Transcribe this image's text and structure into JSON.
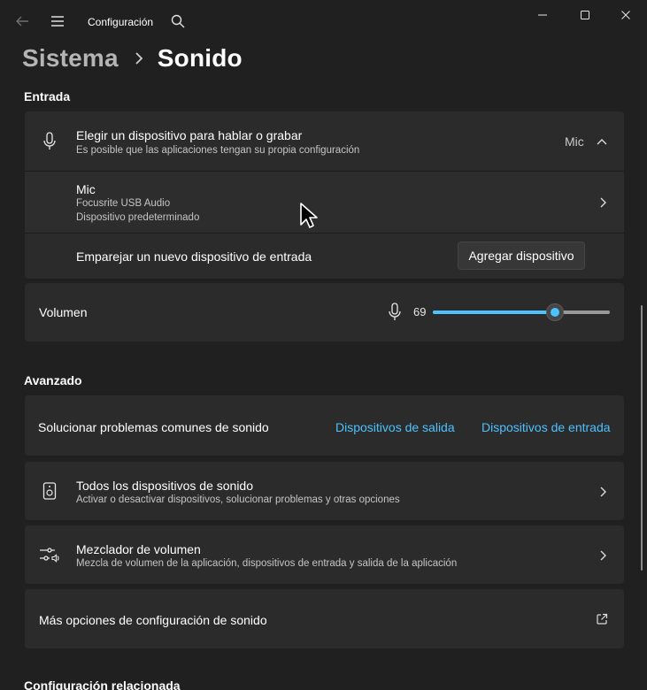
{
  "window": {
    "title": "Configuración",
    "controls": {
      "minimize": "minimize-icon",
      "maximize": "maximize-icon",
      "close": "close-icon"
    }
  },
  "breadcrumb": {
    "parent": "Sistema",
    "current": "Sonido"
  },
  "input_section": {
    "title": "Entrada",
    "device_chooser": {
      "title": "Elegir un dispositivo para hablar o grabar",
      "subtitle": "Es posible que las aplicaciones tengan su propia configuración",
      "selected": "Mic"
    },
    "device": {
      "name": "Mic",
      "detail1": "Focusrite USB Audio",
      "detail2": "Dispositivo predeterminado"
    },
    "pair": {
      "label": "Emparejar un nuevo dispositivo de entrada",
      "button": "Agregar dispositivo"
    },
    "volume": {
      "label": "Volumen",
      "value": "69",
      "level": 69
    }
  },
  "advanced_section": {
    "title": "Avanzado",
    "troubleshoot": {
      "label": "Solucionar problemas comunes de sonido",
      "link_output": "Dispositivos de salida",
      "link_input": "Dispositivos de entrada"
    },
    "all_devices": {
      "title": "Todos los dispositivos de sonido",
      "subtitle": "Activar o desactivar dispositivos, solucionar problemas y otras opciones"
    },
    "mixer": {
      "title": "Mezclador de volumen",
      "subtitle": "Mezcla de volumen de la aplicación, dispositivos de entrada y salida de la aplicación"
    },
    "more_options": {
      "label": "Más opciones de configuración de sonido"
    }
  },
  "related_section": {
    "title": "Configuración relacionada"
  },
  "colors": {
    "background": "#202020",
    "card": "#2b2b2b",
    "accent": "#4cc2ff"
  }
}
